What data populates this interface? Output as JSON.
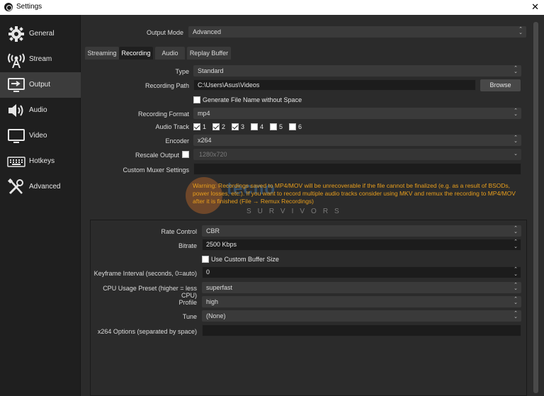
{
  "window": {
    "title": "Settings",
    "close_glyph": "✕"
  },
  "sidebar": {
    "items": [
      {
        "label": "General",
        "icon": "gear-icon"
      },
      {
        "label": "Stream",
        "icon": "antenna-icon"
      },
      {
        "label": "Output",
        "icon": "monitor-arrow-icon",
        "active": true
      },
      {
        "label": "Audio",
        "icon": "speaker-icon"
      },
      {
        "label": "Video",
        "icon": "monitor-icon"
      },
      {
        "label": "Hotkeys",
        "icon": "keyboard-icon"
      },
      {
        "label": "Advanced",
        "icon": "tools-icon"
      }
    ]
  },
  "output_mode": {
    "label": "Output Mode",
    "value": "Advanced"
  },
  "tabs": [
    "Streaming",
    "Recording",
    "Audio",
    "Replay Buffer"
  ],
  "active_tab": "Recording",
  "recording": {
    "type_label": "Type",
    "type_value": "Standard",
    "path_label": "Recording Path",
    "path_value": "C:\\Users\\Asus\\Videos",
    "browse_label": "Browse",
    "no_space_label": "Generate File Name without Space",
    "no_space_checked": false,
    "format_label": "Recording Format",
    "format_value": "mp4",
    "audio_track_label": "Audio Track",
    "tracks": [
      {
        "n": "1",
        "checked": true
      },
      {
        "n": "2",
        "checked": true
      },
      {
        "n": "3",
        "checked": true
      },
      {
        "n": "4",
        "checked": false
      },
      {
        "n": "5",
        "checked": false
      },
      {
        "n": "6",
        "checked": false
      }
    ],
    "encoder_label": "Encoder",
    "encoder_value": "x264",
    "rescale_label": "Rescale Output",
    "rescale_checked": false,
    "rescale_value": "1280x720",
    "muxer_label": "Custom Muxer Settings",
    "muxer_value": "",
    "warning": "Warning: Recordings saved to MP4/MOV will be unrecoverable if the file cannot be finalized (e.g. as a result of BSODs, power losses, etc.). If you want to record multiple audio tracks consider using MKV and remux the recording to MP4/MOV after it is finished (File → Remux Recordings)"
  },
  "encoder_settings": {
    "rate_control_label": "Rate Control",
    "rate_control_value": "CBR",
    "bitrate_label": "Bitrate",
    "bitrate_value": "2500 Kbps",
    "buffer_label": "Use Custom Buffer Size",
    "buffer_checked": false,
    "keyframe_label": "Keyframe Interval (seconds, 0=auto)",
    "keyframe_value": "0",
    "cpu_label": "CPU Usage Preset (higher = less CPU)",
    "cpu_value": "superfast",
    "profile_label": "Profile",
    "profile_value": "high",
    "tune_label": "Tune",
    "tune_value": "(None)",
    "x264opts_label": "x264 Options (separated by space)",
    "x264opts_value": ""
  },
  "watermark": {
    "word1": "tecno",
    "word2": "SURVIVORS"
  },
  "colors": {
    "accent_warning": "#e89e1c",
    "active_nav": "#3c3c3c",
    "background": "#2b2b2b"
  }
}
